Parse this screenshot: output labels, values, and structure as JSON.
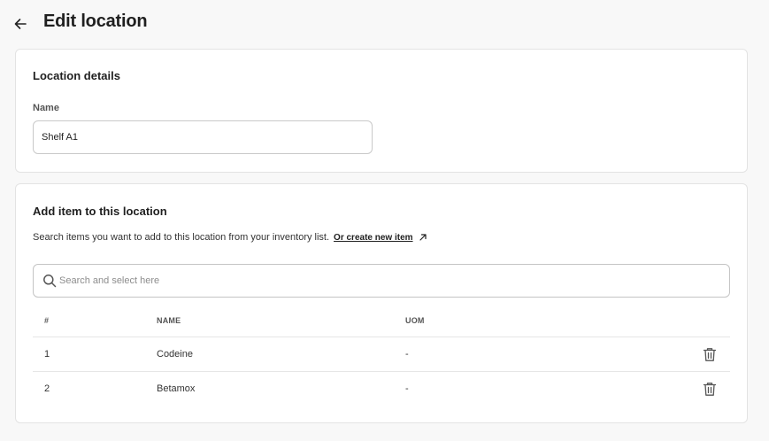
{
  "header": {
    "title": "Edit location",
    "back_icon": "arrow-left-icon"
  },
  "location_details": {
    "title": "Location details",
    "name_label": "Name",
    "name_value": "Shelf A1"
  },
  "add_item": {
    "title": "Add item to this location",
    "help_text": "Search items you want to add to this location from your inventory list.",
    "create_link": "Or create new item",
    "create_link_icon": "external-link-icon",
    "search_placeholder": "Search and select here",
    "search_icon": "search-icon"
  },
  "table": {
    "headers": [
      "#",
      "NAME",
      "UOM"
    ],
    "rows": [
      {
        "num": "1",
        "name": "Codeine",
        "uom": "-"
      },
      {
        "num": "2",
        "name": "Betamox",
        "uom": "-"
      }
    ],
    "delete_icon": "trash-icon"
  },
  "colors": {
    "page_bg": "#f8f8f8",
    "card_bg": "#ffffff",
    "border": "#e3e3e3",
    "text": "#1f1f1f"
  }
}
